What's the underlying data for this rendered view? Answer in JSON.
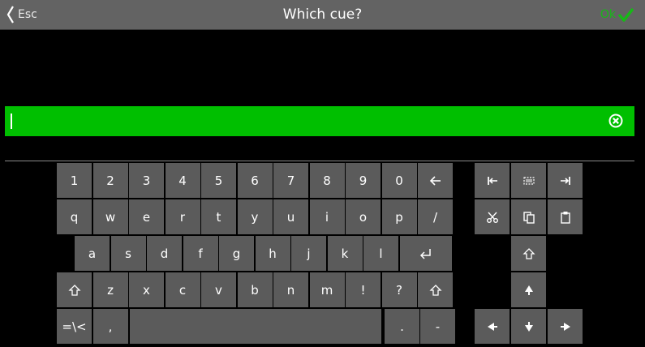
{
  "titlebar": {
    "esc_label": "Esc",
    "title": "Which cue?",
    "ok_label": "Ok"
  },
  "input": {
    "value": ""
  },
  "keys": {
    "r1": [
      "1",
      "2",
      "3",
      "4",
      "5",
      "6",
      "7",
      "8",
      "9",
      "0"
    ],
    "r2": [
      "q",
      "w",
      "e",
      "r",
      "t",
      "y",
      "u",
      "i",
      "o",
      "p",
      "/"
    ],
    "r3": [
      "a",
      "s",
      "d",
      "f",
      "g",
      "h",
      "j",
      "k",
      "l"
    ],
    "r4": [
      "z",
      "x",
      "c",
      "v",
      "b",
      "n",
      "m",
      "!",
      "?"
    ],
    "sym": "=\\<",
    "comma": ",",
    "dot": ".",
    "dash": "-"
  },
  "icons": {
    "backspace": "arrow-left-icon",
    "enter": "enter-icon",
    "shift": "shift-icon",
    "home": "home-icon",
    "select_all": "select-all-icon",
    "end": "end-icon",
    "cut": "scissors-icon",
    "copy": "copy-icon",
    "paste": "paste-icon",
    "up": "arrow-up-icon",
    "down": "arrow-down-icon",
    "left": "arrow-left-icon",
    "right": "arrow-right-icon"
  },
  "colors": {
    "title_bar": "#636363",
    "input_green": "#00bf00",
    "key": "#5b5b5b",
    "ok_green": "#17b817"
  }
}
